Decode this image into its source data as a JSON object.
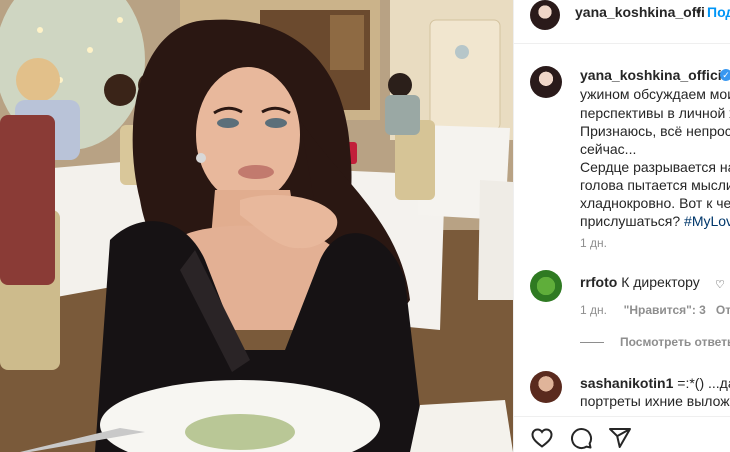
{
  "header": {
    "username": "yana_koshkina_offi",
    "separator": "•",
    "follow_label": "Под"
  },
  "caption": {
    "author": "yana_koshkina_official",
    "verified_icon": "✓",
    "lines": [
      "ужином обсуждаем мои",
      "перспективы в личной ж",
      "Признаюсь, всё непрост",
      "сейчас...",
      "Сердце разрывается на",
      "голова пытается мыслит",
      "хладнокровно. Вот к чем",
      "прислушаться? "
    ],
    "hashtag": "#MyLove",
    "time": "1 дн."
  },
  "comments": [
    {
      "username": "rrfoto",
      "text": "К директору",
      "time": "1 дн.",
      "likes": "\"Нравится\": 3",
      "reply": "Ответ",
      "view_replies": "Посмотреть ответы ("
    },
    {
      "username": "sashanikotin1",
      "text": "=:*() ...да ть",
      "text_line2": "портреты ихние выложи"
    }
  ],
  "actions": [
    "heart-icon",
    "comment-icon",
    "share-icon"
  ],
  "colors": {
    "link": "#0095f6",
    "hashtag": "#00376b",
    "muted": "#8e8e8e",
    "verified": "#3897f0"
  }
}
